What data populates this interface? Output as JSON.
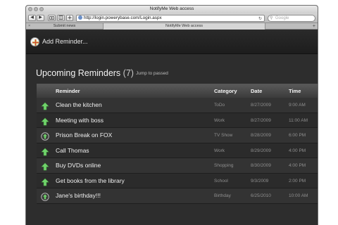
{
  "window": {
    "title": "NotifyMe Web access"
  },
  "toolbar": {
    "back": "◀",
    "forward": "▶",
    "address": "http://login.powerybase.com/Login.aspx",
    "search_placeholder": "Google"
  },
  "tabs": [
    {
      "label": "Submit news",
      "active": false
    },
    {
      "label": "NotifyMe Web access",
      "active": true
    }
  ],
  "app": {
    "add_label": "Add Reminder...",
    "heading": "Upcoming Reminders",
    "heading_count": "(7)",
    "jump_link": "Jump to passed",
    "columns": {
      "reminder": "Reminder",
      "category": "Category",
      "date": "Date",
      "time": "Time"
    },
    "rows": [
      {
        "icon": "up-arrow-icon",
        "title": "Clean the kitchen",
        "category": "ToDo",
        "date": "8/27/2009",
        "time": "9:00 AM"
      },
      {
        "icon": "up-arrow-icon",
        "title": "Meeting with boss",
        "category": "Work",
        "date": "8/27/2009",
        "time": "11:00 AM"
      },
      {
        "icon": "globe-icon",
        "title": "Prison Break on FOX",
        "category": "TV Show",
        "date": "8/28/2009",
        "time": "6:00 PM"
      },
      {
        "icon": "up-arrow-icon",
        "title": "Call Thomas",
        "category": "Work",
        "date": "8/29/2009",
        "time": "4:00 PM"
      },
      {
        "icon": "up-arrow-icon",
        "title": "Buy DVDs online",
        "category": "Shopping",
        "date": "8/30/2009",
        "time": "4:00 PM"
      },
      {
        "icon": "up-arrow-icon",
        "title": "Get books from the library",
        "category": "School",
        "date": "9/3/2009",
        "time": "2:00 PM"
      },
      {
        "icon": "globe-icon",
        "title": "Jane's birthday!!!",
        "category": "Birthday",
        "date": "6/25/2010",
        "time": "10:00 AM"
      }
    ]
  },
  "colors": {
    "icon_green": "#6fd26a",
    "app_background": "#2d2d2d"
  }
}
